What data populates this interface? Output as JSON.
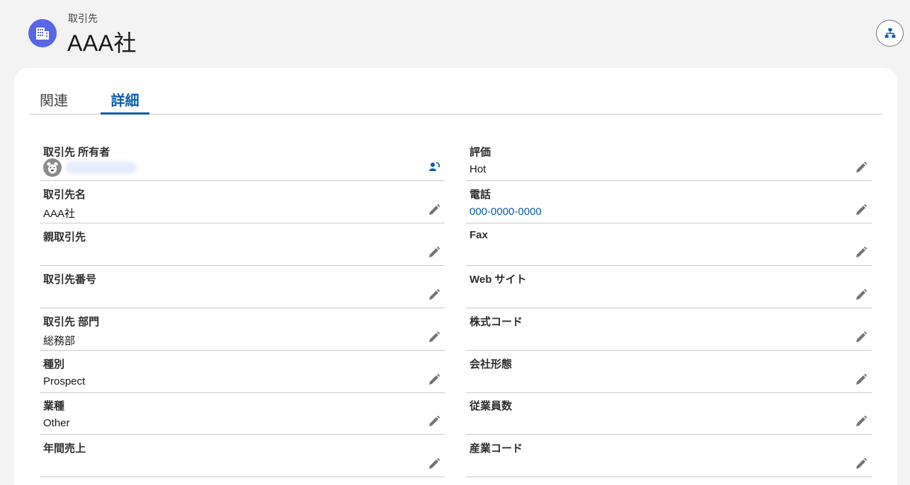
{
  "header": {
    "record_type": "取引先",
    "record_name": "AAA社",
    "record_icon": "building-icon",
    "hierarchy_icon": "hierarchy-icon"
  },
  "tabs": [
    {
      "label": "関連",
      "active": false
    },
    {
      "label": "詳細",
      "active": true
    }
  ],
  "colors": {
    "brand": "#0b5cab",
    "icon_bg": "#5867e8",
    "card_bg": "#ffffff",
    "page_bg": "#f3f3f3"
  },
  "fields_left": [
    {
      "label": "取引先 所有者",
      "value": ""
    },
    {
      "label": "取引先名",
      "value": "AAA社"
    },
    {
      "label": "親取引先",
      "value": ""
    },
    {
      "label": "取引先番号",
      "value": ""
    },
    {
      "label": "取引先 部門",
      "value": "総務部"
    },
    {
      "label": "種別",
      "value": "Prospect"
    },
    {
      "label": "業種",
      "value": "Other"
    },
    {
      "label": "年間売上",
      "value": ""
    }
  ],
  "fields_right": [
    {
      "label": "評価",
      "value": "Hot"
    },
    {
      "label": "電話",
      "value": "000-0000-0000"
    },
    {
      "label": "Fax",
      "value": ""
    },
    {
      "label": "Web サイト",
      "value": ""
    },
    {
      "label": "株式コード",
      "value": ""
    },
    {
      "label": "会社形態",
      "value": ""
    },
    {
      "label": "従業員数",
      "value": ""
    },
    {
      "label": "産業コード",
      "value": ""
    }
  ]
}
